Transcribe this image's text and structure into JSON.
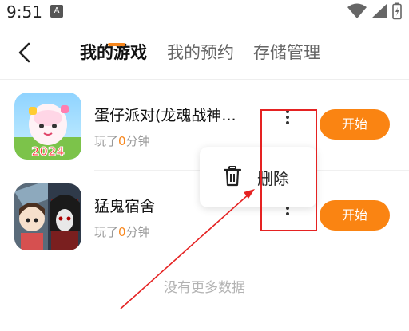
{
  "status_bar": {
    "time": "9:51",
    "notif_letter": "A"
  },
  "tabs": [
    {
      "label": "我的游戏"
    },
    {
      "label": "我的预约"
    },
    {
      "label": "存储管理"
    }
  ],
  "games": [
    {
      "title": "蛋仔派对(龙魂战神...",
      "played_prefix": "玩了",
      "minutes": "0",
      "played_suffix": "分钟",
      "start_label": "开始",
      "icon_text": "2024"
    },
    {
      "title": "猛鬼宿舍",
      "played_prefix": "玩了",
      "minutes": "0",
      "played_suffix": "分钟",
      "start_label": "开始"
    }
  ],
  "popup": {
    "delete_label": "删除"
  },
  "footer": {
    "no_more": "没有更多数据"
  },
  "colors": {
    "accent": "#fa8412",
    "annotation": "#e52222"
  }
}
